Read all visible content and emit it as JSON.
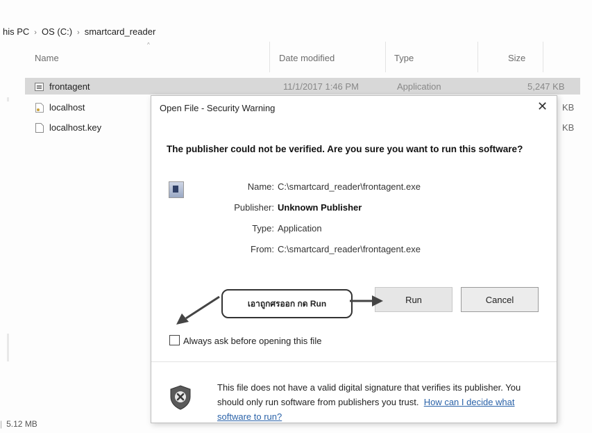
{
  "breadcrumb": {
    "items": [
      "his PC",
      "OS (C:)",
      "smartcard_reader"
    ],
    "separator": "›"
  },
  "columns": {
    "name": "Name",
    "date_modified": "Date modified",
    "type": "Type",
    "size": "Size"
  },
  "files": [
    {
      "name": "frontagent",
      "date": "11/1/2017 1:46 PM",
      "type": "Application",
      "size": "5,247 KB",
      "icon": "exe-icon",
      "selected": true
    },
    {
      "name": "localhost",
      "size_partial": "KB",
      "icon": "certificate-file-icon"
    },
    {
      "name": "localhost.key",
      "size_partial": "KB",
      "icon": "blank-file-icon"
    }
  ],
  "status_bar": {
    "size": "5.12 MB"
  },
  "dialog": {
    "title": "Open File - Security Warning",
    "close_glyph": "✕",
    "heading": "The publisher could not be verified.  Are you sure you want to run this software?",
    "details": {
      "name_label": "Name:",
      "name_value": "C:\\smartcard_reader\\frontagent.exe",
      "publisher_label": "Publisher:",
      "publisher_value": "Unknown Publisher",
      "type_label": "Type:",
      "type_value": "Application",
      "from_label": "From:",
      "from_value": "C:\\smartcard_reader\\frontagent.exe"
    },
    "run_label": "Run",
    "cancel_label": "Cancel",
    "always_ask_label": "Always ask before opening this file",
    "always_ask_checked": false,
    "footer_text": "This file does not have a valid digital signature that verifies its publisher.  You should only run software from publishers you trust.",
    "footer_link": "How can I decide what software to run?"
  },
  "annotation": {
    "callout_text": "เอาถูกศรออก กด Run",
    "color": "#333333"
  }
}
